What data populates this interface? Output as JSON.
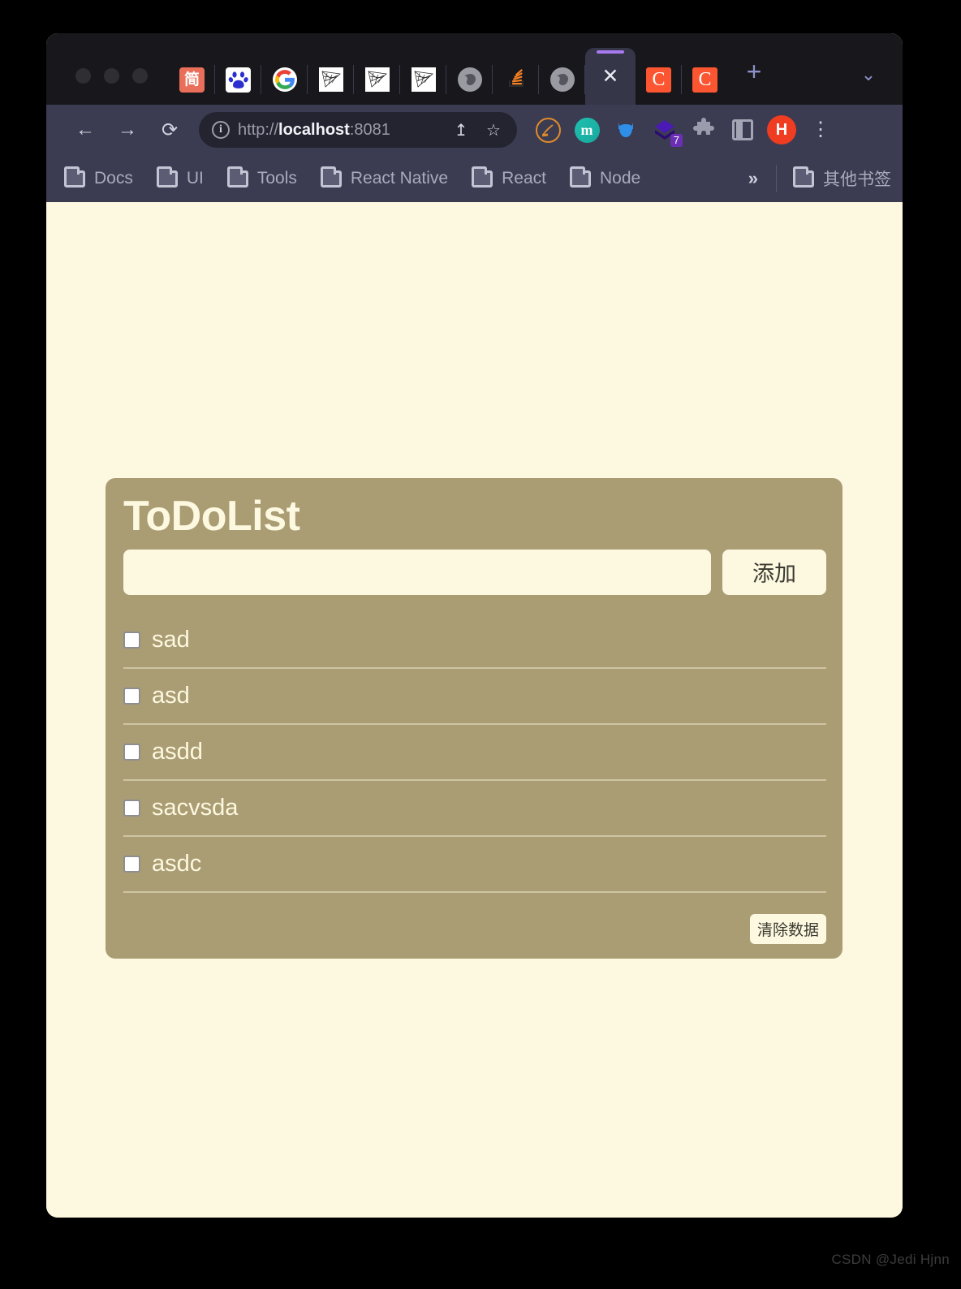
{
  "browser": {
    "window_controls": [
      "close",
      "minimize",
      "maximize"
    ],
    "tabs": [
      {
        "icon": "jianshu-icon",
        "glyph": "简",
        "title": "简书",
        "active": false
      },
      {
        "icon": "baidu-icon",
        "glyph": "du",
        "title": "百度",
        "active": false
      },
      {
        "icon": "google-icon",
        "glyph": "G",
        "title": "Google",
        "active": false
      },
      {
        "icon": "mesh-icon-1",
        "glyph": "",
        "title": "Mesh",
        "active": false
      },
      {
        "icon": "mesh-icon-2",
        "glyph": "",
        "title": "Mesh",
        "active": false
      },
      {
        "icon": "mesh-icon-3",
        "glyph": "",
        "title": "Mesh",
        "active": false
      },
      {
        "icon": "globe-icon-1",
        "glyph": "",
        "title": "Web Page",
        "active": false
      },
      {
        "icon": "stackoverflow-icon",
        "glyph": "",
        "title": "Stack Overflow",
        "active": false
      },
      {
        "icon": "globe-icon-2",
        "glyph": "",
        "title": "Web Page",
        "active": false
      },
      {
        "icon": "close-icon",
        "glyph": "✕",
        "title": "localhost:8081",
        "active": true
      },
      {
        "icon": "csdn-icon-1",
        "glyph": "C",
        "title": "CSDN",
        "active": false
      },
      {
        "icon": "csdn-icon-2",
        "glyph": "C",
        "title": "CSDN",
        "active": false
      }
    ],
    "new_tab_label": "+",
    "tab_list_chevron": "⌄",
    "toolbar": {
      "back_label": "←",
      "forward_label": "→",
      "reload_label": "⟳",
      "info_label": "i",
      "url_prefix": "http://",
      "url_host": "localhost",
      "url_suffix": ":8081",
      "share_label": "↥",
      "bookmark_star_label": "☆",
      "menu_label": "⋮",
      "extensions": [
        {
          "name": "pen-circle-icon",
          "label": ""
        },
        {
          "name": "markdown-m-icon",
          "label": "m"
        },
        {
          "name": "cat-icon",
          "label": ""
        },
        {
          "name": "layers-icon",
          "label": "",
          "badge": "7"
        },
        {
          "name": "puzzle-icon",
          "label": ""
        },
        {
          "name": "side-panel-icon",
          "label": ""
        },
        {
          "name": "profile-avatar",
          "label": "H"
        }
      ]
    },
    "bookmarks": {
      "items": [
        {
          "label": "Docs"
        },
        {
          "label": "UI"
        },
        {
          "label": "Tools"
        },
        {
          "label": "React Native"
        },
        {
          "label": "React"
        },
        {
          "label": "Node"
        }
      ],
      "overflow_label": "»",
      "other_bookmarks_label": "其他书签"
    }
  },
  "page": {
    "background_color": "#fdf8e0",
    "card_color": "#aa9d74",
    "todo": {
      "title": "ToDoList",
      "input_value": "",
      "input_placeholder": "",
      "add_button_label": "添加",
      "clear_button_label": "清除数据",
      "items": [
        {
          "text": "sad",
          "checked": false
        },
        {
          "text": "asd",
          "checked": false
        },
        {
          "text": "asdd",
          "checked": false
        },
        {
          "text": "sacvsda",
          "checked": false
        },
        {
          "text": "asdc",
          "checked": false
        }
      ]
    }
  },
  "watermark": {
    "text": "CSDN @Jedi Hjnn"
  }
}
